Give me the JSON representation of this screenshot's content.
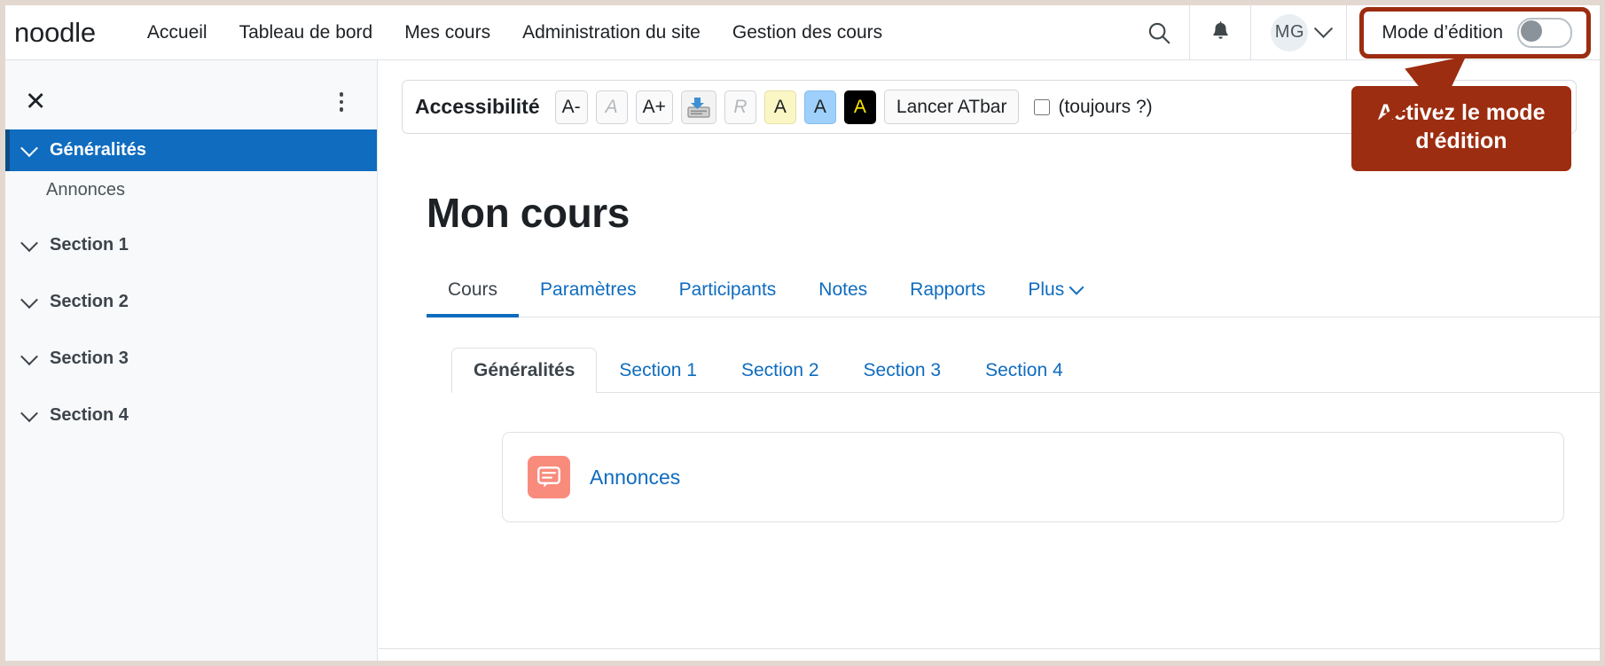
{
  "brand": {
    "logo_text": "noodle"
  },
  "navbar": {
    "links": [
      {
        "label": "Accueil"
      },
      {
        "label": "Tableau de bord"
      },
      {
        "label": "Mes cours"
      },
      {
        "label": "Administration du site"
      },
      {
        "label": "Gestion des cours"
      }
    ],
    "search_icon": "search-icon",
    "notifications_icon": "bell-icon",
    "avatar_initials": "MG",
    "edit_mode": {
      "label": "Mode d’édition",
      "state": "off",
      "highlight_color": "#9c2d10"
    }
  },
  "annotation": {
    "text": "Activez le mode d'édition",
    "background": "#9c2d10",
    "text_color": "#ffffff"
  },
  "sidebar": {
    "close_label": "✕",
    "menu_icon": "kebab-menu-icon",
    "items": [
      {
        "label": "Généralités",
        "active": true,
        "type": "section"
      },
      {
        "label": "Annonces",
        "active": false,
        "type": "activity"
      },
      {
        "label": "Section 1",
        "active": false,
        "type": "section"
      },
      {
        "label": "Section 2",
        "active": false,
        "type": "section"
      },
      {
        "label": "Section 3",
        "active": false,
        "type": "section"
      },
      {
        "label": "Section 4",
        "active": false,
        "type": "section"
      }
    ],
    "active_color": "#0f6cbf"
  },
  "accessibility_bar": {
    "title": "Accessibilité",
    "buttons": [
      {
        "label": "A-",
        "name": "decrease-font-button",
        "style": "normal"
      },
      {
        "label": "A",
        "name": "reset-font-button",
        "style": "dim"
      },
      {
        "label": "A+",
        "name": "increase-font-button",
        "style": "normal"
      },
      {
        "label": "",
        "name": "save-settings-icon-button",
        "style": "image"
      },
      {
        "label": "R",
        "name": "reset-styles-button",
        "style": "dim"
      },
      {
        "label": "A",
        "name": "contrast-yellow-button",
        "style": "yellow"
      },
      {
        "label": "A",
        "name": "contrast-blue-button",
        "style": "blue"
      },
      {
        "label": "A",
        "name": "contrast-black-button",
        "style": "black"
      }
    ],
    "launch_button": "Lancer ATbar",
    "always_checkbox_label": "(toujours ?)",
    "always_checked": false
  },
  "main": {
    "page_title": "Mon cours",
    "course_tabs": [
      {
        "label": "Cours",
        "active": true,
        "dropdown": false
      },
      {
        "label": "Paramètres",
        "active": false,
        "dropdown": false
      },
      {
        "label": "Participants",
        "active": false,
        "dropdown": false
      },
      {
        "label": "Notes",
        "active": false,
        "dropdown": false
      },
      {
        "label": "Rapports",
        "active": false,
        "dropdown": false
      },
      {
        "label": "Plus",
        "active": false,
        "dropdown": true
      }
    ],
    "section_tabs": [
      {
        "label": "Généralités",
        "active": true
      },
      {
        "label": "Section 1",
        "active": false
      },
      {
        "label": "Section 2",
        "active": false
      },
      {
        "label": "Section 3",
        "active": false
      },
      {
        "label": "Section 4",
        "active": false
      }
    ],
    "activities": [
      {
        "label": "Annonces",
        "icon": "forum-icon",
        "icon_color": "#f98b7d"
      }
    ]
  }
}
